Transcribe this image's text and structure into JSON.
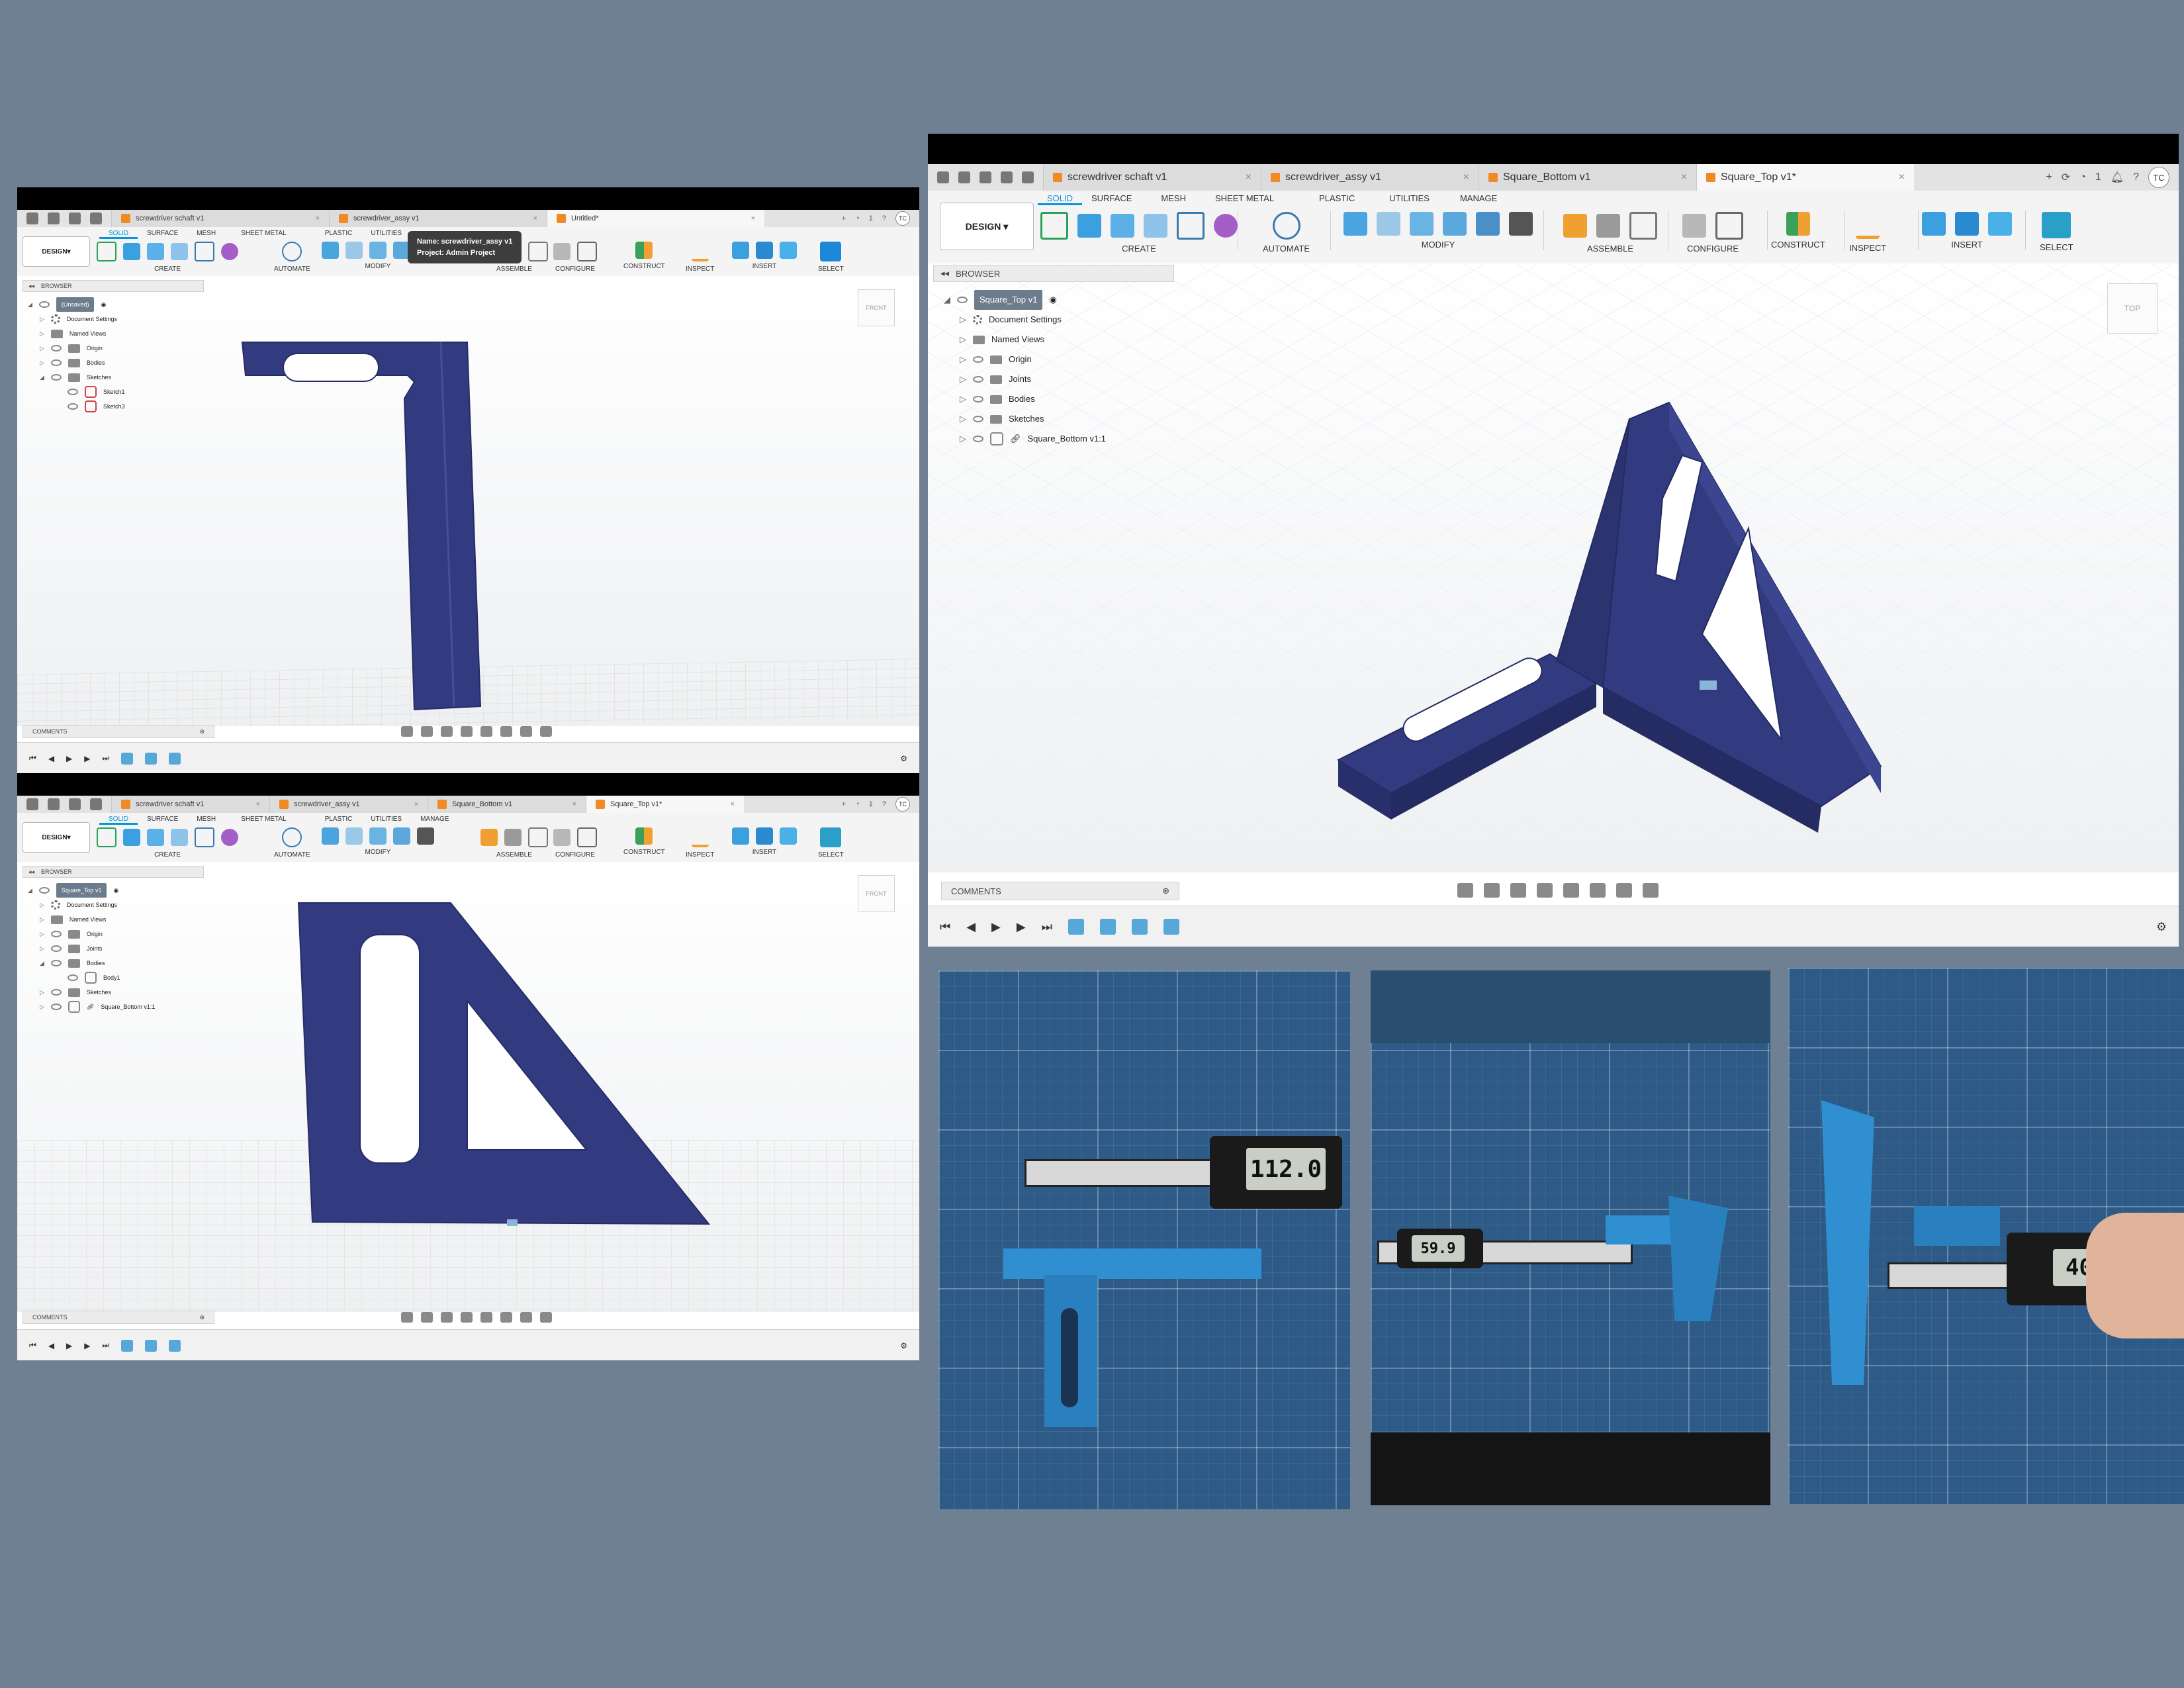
{
  "app": {
    "workspace": "DESIGN",
    "workspace_tabs": [
      "SOLID",
      "SURFACE",
      "MESH",
      "SHEET METAL",
      "PLASTIC",
      "UTILITIES",
      "MANAGE"
    ],
    "groups": [
      "CREATE",
      "AUTOMATE",
      "MODIFY",
      "ASSEMBLE",
      "CONFIGURE",
      "CONSTRUCT",
      "INSPECT",
      "INSERT",
      "SELECT"
    ],
    "browser_label": "BROWSER",
    "comments_label": "COMMENTS",
    "user_initials": "TC",
    "notification_count": "1"
  },
  "win1": {
    "tabs": [
      "screwdriver schaft v1",
      "screwdriver_assy v1",
      "Untitled*"
    ],
    "tooltip_name": "Name: screwdriver_assy v1",
    "tooltip_project": "Project: Admin Project",
    "root": "(Unsaved)",
    "tree": [
      "Document Settings",
      "Named Views",
      "Origin",
      "Bodies",
      "Sketches",
      "Sketch1",
      "Sketch3"
    ],
    "viewcube": "FRONT"
  },
  "win2": {
    "tabs": [
      "screwdriver schaft v1",
      "screwdriver_assy v1",
      "Square_Bottom v1",
      "Square_Top v1*"
    ],
    "root": "Square_Top v1",
    "tree": [
      "Document Settings",
      "Named Views",
      "Origin",
      "Joints",
      "Bodies",
      "Body1",
      "Sketches",
      "Square_Bottom v1:1"
    ],
    "viewcube": "FRONT"
  },
  "win3": {
    "tabs": [
      "screwdriver schaft v1",
      "screwdriver_assy v1",
      "Square_Bottom v1",
      "Square_Top v1*"
    ],
    "root": "Square_Top v1",
    "tree": [
      "Document Settings",
      "Named Views",
      "Origin",
      "Joints",
      "Bodies",
      "Sketches",
      "Square_Bottom v1:1"
    ],
    "viewcube": "TOP"
  },
  "photos": {
    "reading1": "112.0",
    "reading2": "59.9",
    "reading3": "40.0"
  },
  "colors": {
    "background": "#6f8093",
    "model": "#323b80",
    "accent": "#0696d7",
    "part_blue": "#2f8fd0"
  }
}
